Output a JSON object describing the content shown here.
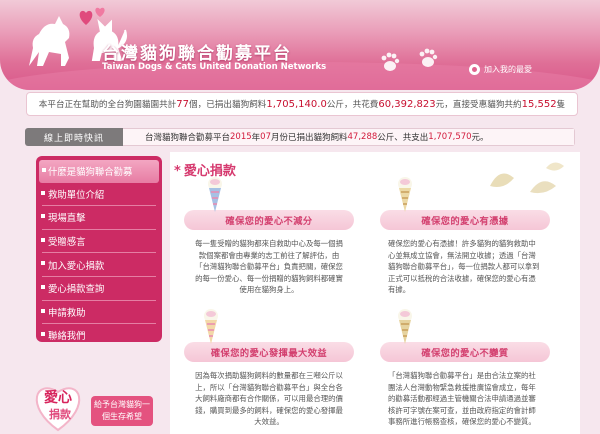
{
  "header": {
    "title_zh": "台灣貓狗聯合勸募平台",
    "title_en": "Taiwan Dogs & Cats United Donation Networks",
    "favorite_label": "加入我的最愛"
  },
  "stats": {
    "p1": "本平台正在幫助的全台狗園貓園共計",
    "count": "77",
    "p2": "個，已捐出貓狗飼料",
    "feed": "1,705,140.0",
    "p3": "公斤，共花費",
    "cost": "60,392,823",
    "p4": "元，直接受惠貓狗共約",
    "animals": "15,552",
    "p5": "隻"
  },
  "news": {
    "label": "線上即時快訊",
    "p1": "台灣貓狗聯合勸募平台",
    "year": "2015",
    "p2": "年",
    "month": "07",
    "p3": "月份已捐出貓狗飼料",
    "kg": "47,288",
    "p4": "公斤、共支出",
    "spend": "1,707,570",
    "p5": "元。"
  },
  "sidebar": {
    "items": [
      {
        "label": "什麼是貓狗聯合勸募"
      },
      {
        "label": "救助單位介紹"
      },
      {
        "label": "現場直擊"
      },
      {
        "label": "受贈感言"
      },
      {
        "label": "加入愛心捐款"
      },
      {
        "label": "愛心捐款查詢"
      },
      {
        "label": "申請救助"
      },
      {
        "label": "聯絡我們"
      }
    ],
    "badge_text": "愛心捐款",
    "badge_button": "給予台灣貓狗一個生存希望"
  },
  "content": {
    "title": "愛心捐款",
    "cards": [
      {
        "title": "確保您的愛心不減分",
        "body": "每一隻受贈的貓狗都來自救助中心及每一個捐款個案都會由專業的志工前往了解評估，由「台灣貓狗聯合勸募平台」負責把關，確保您的每一份愛心、每一份捐贈的貓狗飼料都確實使用在貓狗身上。"
      },
      {
        "title": "確保您的愛心有憑據",
        "body": "確保您的愛心有憑據！許多貓狗的貓狗救助中心並無成立協會，無法開立收據；透過「台灣貓狗聯合勸募平台」，每一位捐款人都可以拿到正式可以抵稅的合法收據，確保您的愛心有憑有據。"
      },
      {
        "title": "確保您的愛心發揮最大效益",
        "body": "因為每次捐助貓狗飼料的數量都在三噸公斤以上，所以「台灣貓狗聯合勸募平台」與全台各大飼料廠商都有合作關係，可以用最合理的價錢，購買到最多的飼料，確保您的愛心發揮最大效益。"
      },
      {
        "title": "確保您的愛心不變質",
        "body": "「台灣貓狗聯合勸募平台」是由合法立案的社團法人台灣動物緊急救援推廣協會成立，每年的勸募活動都經過主管機關合法申請通過並審核許可字號在案可查，並由政府指定的會計師事務所進行帳務查核，確保您的愛心不變質。"
      }
    ]
  }
}
